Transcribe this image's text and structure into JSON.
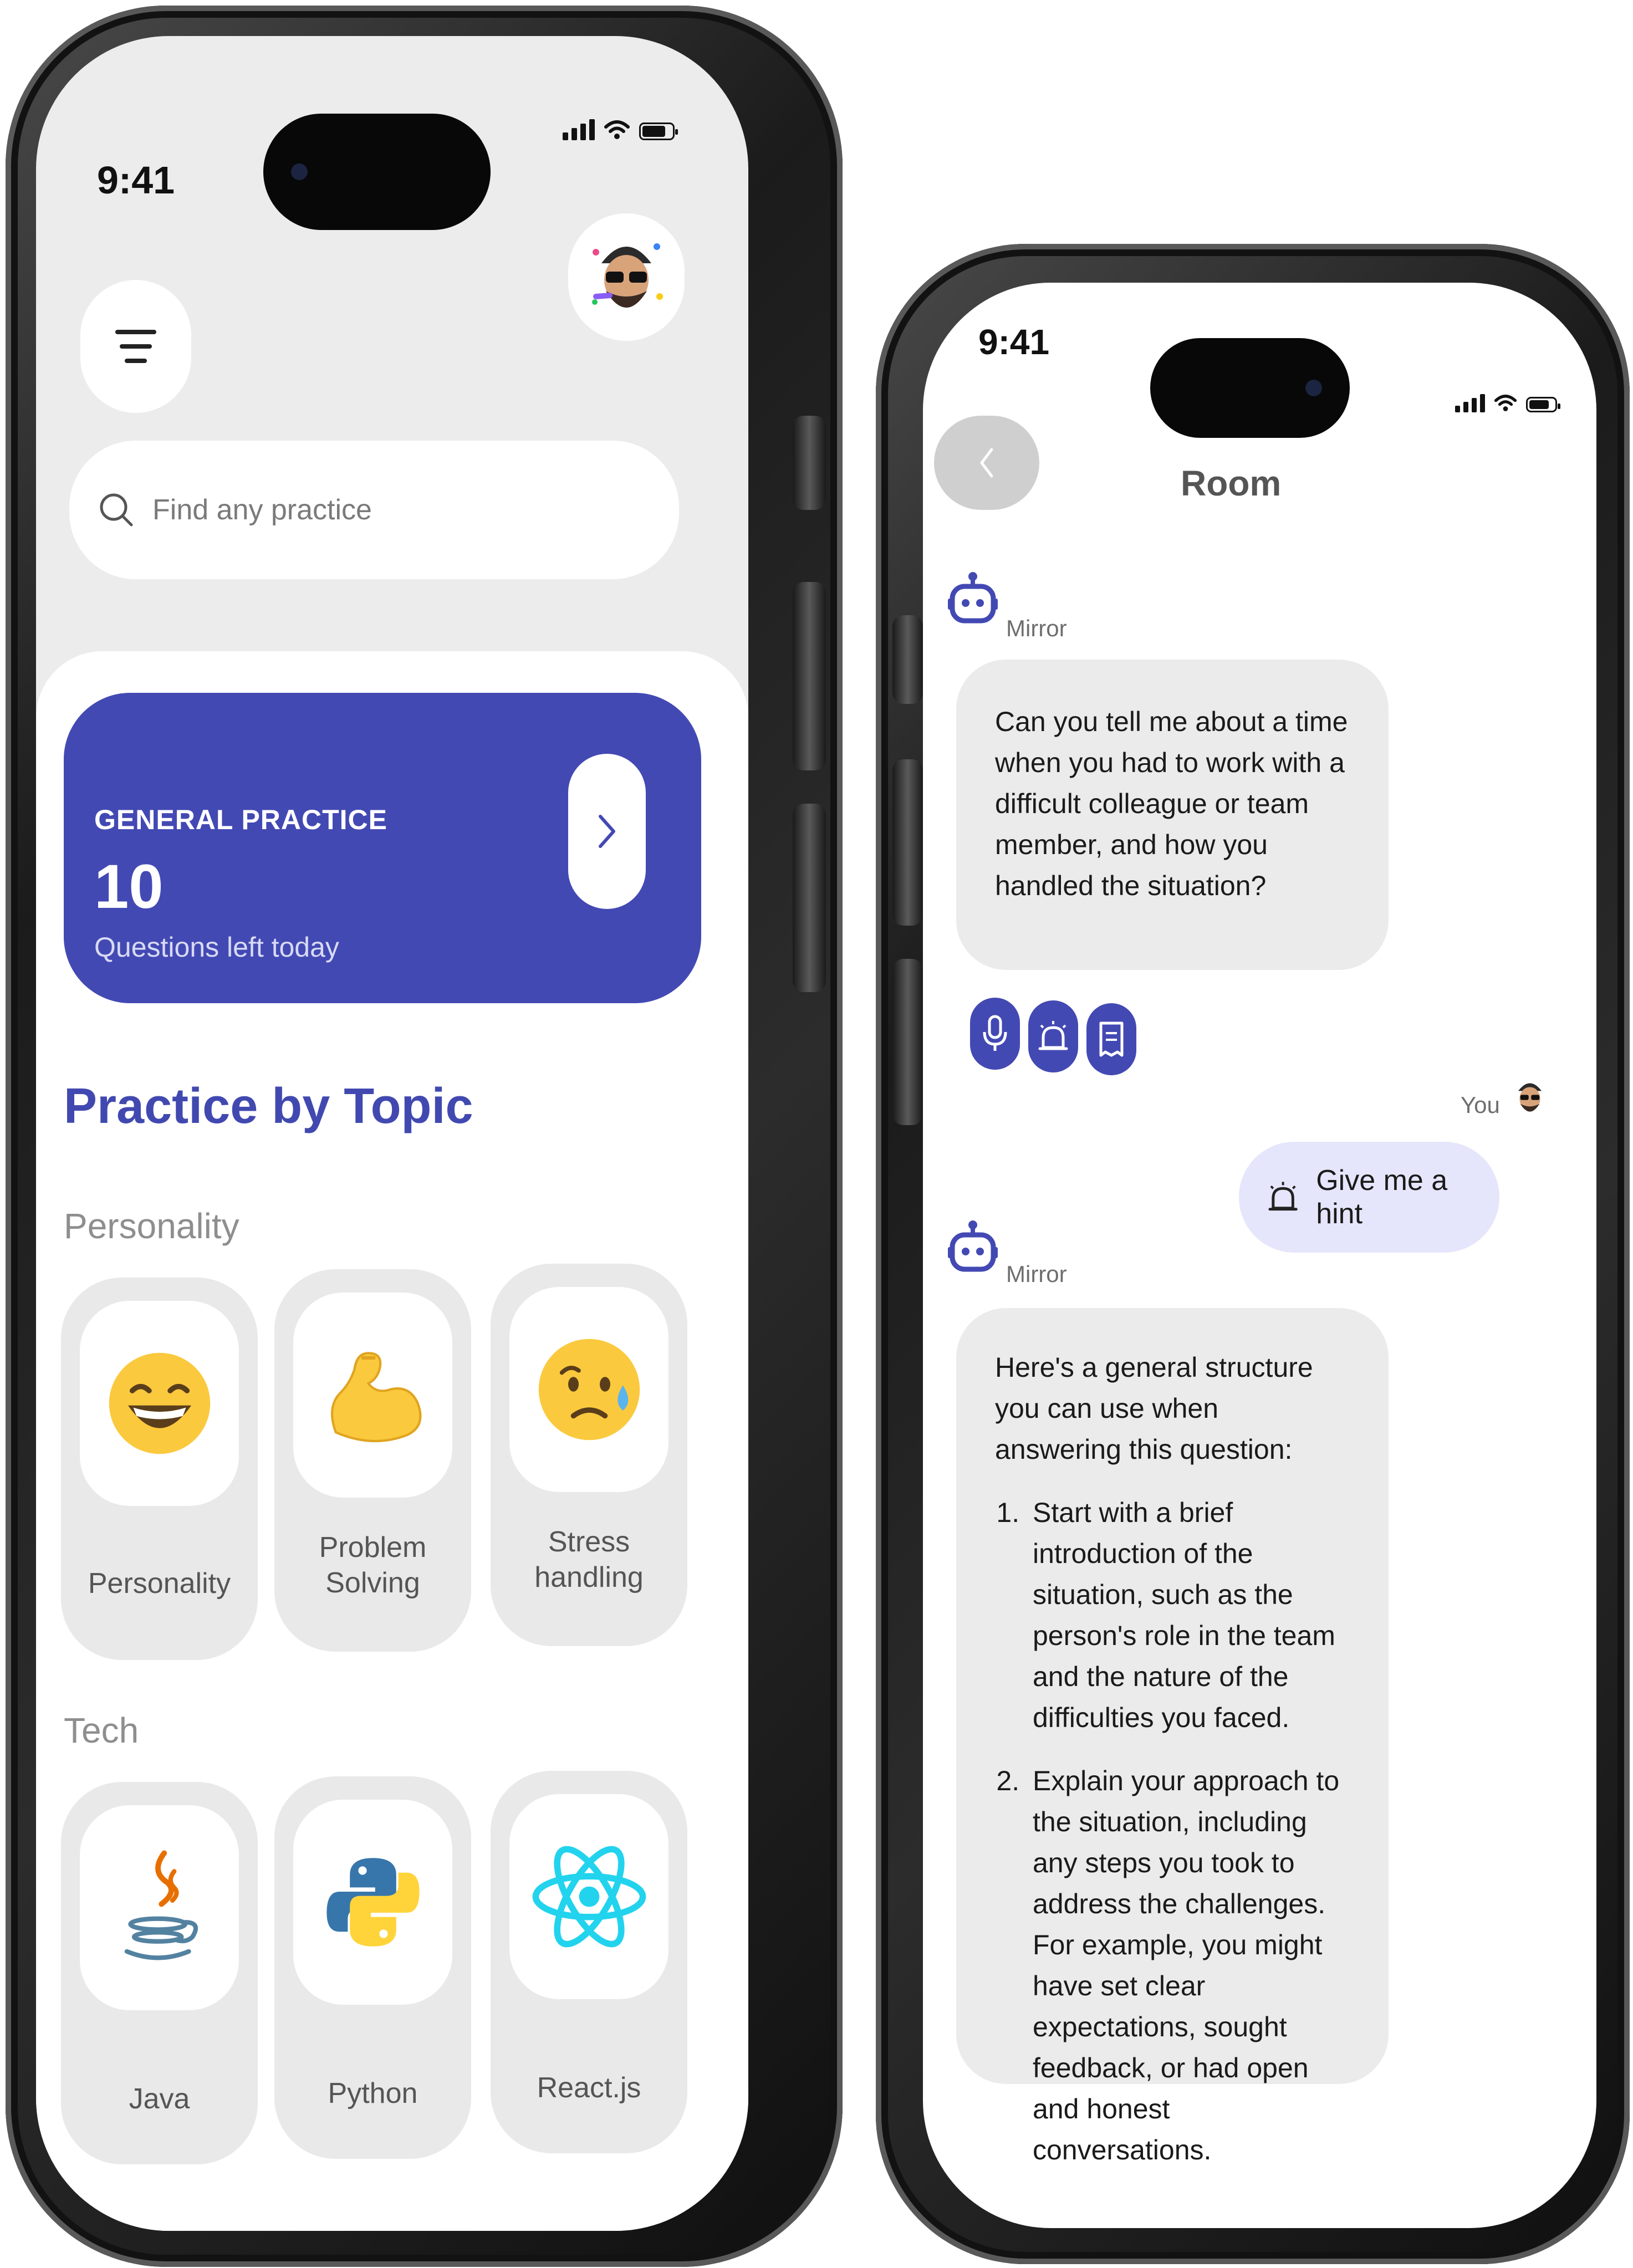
{
  "left_phone": {
    "status_time": "9:41",
    "search_placeholder": "Find any practice",
    "general_practice": {
      "title": "GENERAL PRACTICE",
      "count": "10",
      "subtitle": "Questions left today"
    },
    "section_title": "Practice by Topic",
    "groups": [
      {
        "label": "Personality",
        "tiles": [
          {
            "label": "Personality",
            "icon": "grinning-face-emoji"
          },
          {
            "label": "Problem\nSolving",
            "icon": "flexed-biceps-emoji"
          },
          {
            "label": "Stress\nhandling",
            "icon": "anxious-sweat-face-emoji"
          }
        ]
      },
      {
        "label": "Tech",
        "tiles": [
          {
            "label": "Java",
            "icon": "java-logo"
          },
          {
            "label": "Python",
            "icon": "python-logo"
          },
          {
            "label": "React.js",
            "icon": "react-logo"
          }
        ]
      }
    ]
  },
  "right_phone": {
    "status_time": "9:41",
    "title": "Room",
    "messages": {
      "bot_name": "Mirror",
      "user_name": "You",
      "question": "Can you tell me about a time when you had to work with a difficult colleague or team member, and how you handled the situation?",
      "hint_request": "Give me a hint",
      "answer_intro": "Here's a general structure you can use when answering this question:",
      "answer_steps": [
        "Start with a brief introduction of the situation, such as the person's role in the team and the nature of the difficulties you faced.",
        "Explain your approach to the situation, including any steps you took to address the challenges. For example, you might have set clear expectations, sought feedback, or had open and honest conversations."
      ]
    },
    "actions": [
      "microphone-icon",
      "alarm-bell-icon",
      "notes-icon"
    ]
  },
  "colors": {
    "accent": "#4349b3",
    "hint_bg": "#e5e6fb",
    "bubble_bg": "#ebebeb"
  }
}
